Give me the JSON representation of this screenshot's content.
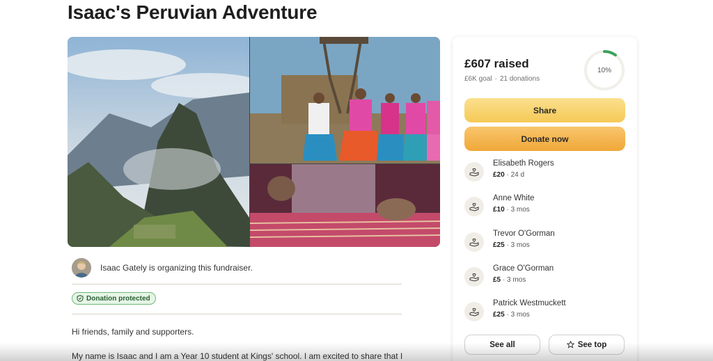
{
  "campaign": {
    "title": "Isaac's Peruvian Adventure",
    "organizer_text": "Isaac Gately is organizing this fundraiser.",
    "protected_label": "Donation protected",
    "body": [
      "Hi friends, family and supporters.",
      "My name is Isaac and I am a Year 10 student at Kings' school. I am excited to share that I"
    ]
  },
  "stats": {
    "raised": "£607 raised",
    "goal": "£6K goal",
    "donations": "21 donations",
    "progress_label": "10%",
    "progress_fraction": 0.1
  },
  "buttons": {
    "share": "Share",
    "donate": "Donate now",
    "see_all": "See all",
    "see_top": "See top"
  },
  "donors": [
    {
      "name": "Elisabeth Rogers",
      "amount": "£20",
      "time": " · 24 d"
    },
    {
      "name": "Anne White",
      "amount": "£10",
      "time": " · 3 mos"
    },
    {
      "name": "Trevor O'Gorman",
      "amount": "£25",
      "time": " · 3 mos"
    },
    {
      "name": "Grace O'Gorman",
      "amount": "£5",
      "time": " · 3 mos"
    },
    {
      "name": "Patrick Westmuckett",
      "amount": "£25",
      "time": " · 3 mos"
    }
  ],
  "colors": {
    "progress": "#3aa35a",
    "share_button": "#f6c956",
    "donate_button": "#f0a838",
    "protected_badge": "#e5f5e6"
  }
}
